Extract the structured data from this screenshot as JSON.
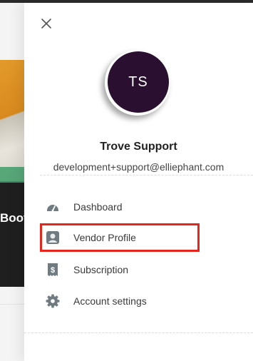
{
  "background": {
    "card_title": "Boot"
  },
  "drawer": {
    "close_icon": "close-icon",
    "avatar_initials": "TS",
    "user_name": "Trove Support",
    "user_email": "development+support@elliephant.com",
    "menu": [
      {
        "label": "Dashboard",
        "icon": "dashboard-gauge-icon"
      },
      {
        "label": "Vendor Profile",
        "icon": "vendor-profile-icon",
        "highlighted": true
      },
      {
        "label": "Subscription",
        "icon": "subscription-receipt-icon"
      },
      {
        "label": "Account settings",
        "icon": "settings-gear-icon"
      }
    ]
  },
  "colors": {
    "avatar_bg": "#2a0f30",
    "highlight_border": "#e6261b",
    "icon": "#6f7b80"
  }
}
